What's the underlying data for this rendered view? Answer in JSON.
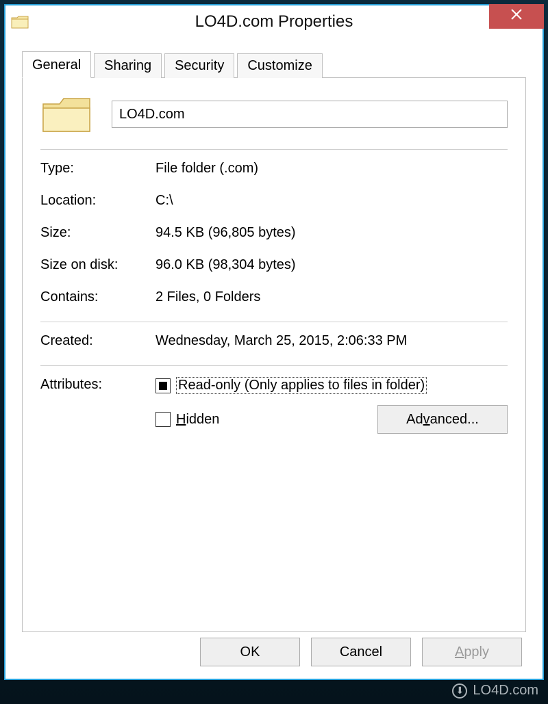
{
  "titlebar": {
    "title": "LO4D.com Properties"
  },
  "tabs": {
    "general": "General",
    "sharing": "Sharing",
    "security": "Security",
    "customize": "Customize"
  },
  "general": {
    "name_value": "LO4D.com",
    "type_label": "Type:",
    "type_value": "File folder (.com)",
    "location_label": "Location:",
    "location_value": "C:\\",
    "size_label": "Size:",
    "size_value": "94.5 KB (96,805 bytes)",
    "sizeondisk_label": "Size on disk:",
    "sizeondisk_value": "96.0 KB (98,304 bytes)",
    "contains_label": "Contains:",
    "contains_value": "2 Files, 0 Folders",
    "created_label": "Created:",
    "created_value": "Wednesday, March 25, 2015, 2:06:33 PM",
    "attributes_label": "Attributes:",
    "readonly_label": "Read-only (Only applies to files in folder)",
    "hidden_label_pre": "",
    "hidden_key": "H",
    "hidden_label_post": "idden",
    "advanced_pre": "Ad",
    "advanced_key": "v",
    "advanced_post": "anced..."
  },
  "buttons": {
    "ok": "OK",
    "cancel": "Cancel",
    "apply_pre": "",
    "apply_key": "A",
    "apply_post": "pply"
  },
  "watermark": "LO4D.com"
}
